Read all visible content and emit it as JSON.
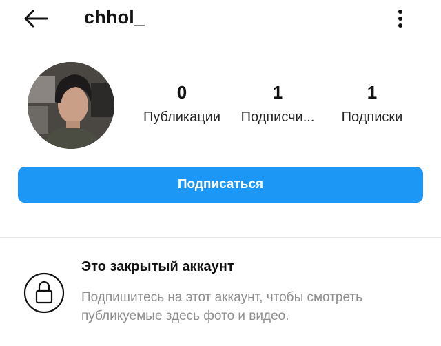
{
  "header": {
    "username": "chhol_",
    "back_icon": "arrow-left-icon",
    "more_icon": "more-vertical-icon"
  },
  "profile": {
    "avatar_icon": "profile-avatar",
    "stats": [
      {
        "value": "0",
        "label": "Публикации"
      },
      {
        "value": "1",
        "label": "Подписчи..."
      },
      {
        "value": "1",
        "label": "Подписки"
      }
    ]
  },
  "actions": {
    "follow_label": "Подписаться",
    "follow_color": "#1d97f5"
  },
  "private_notice": {
    "icon": "lock-icon",
    "title": "Это закрытый аккаунт",
    "description": "Подпишитесь на этот аккаунт, чтобы смотреть публикуемые здесь фото и видео."
  }
}
